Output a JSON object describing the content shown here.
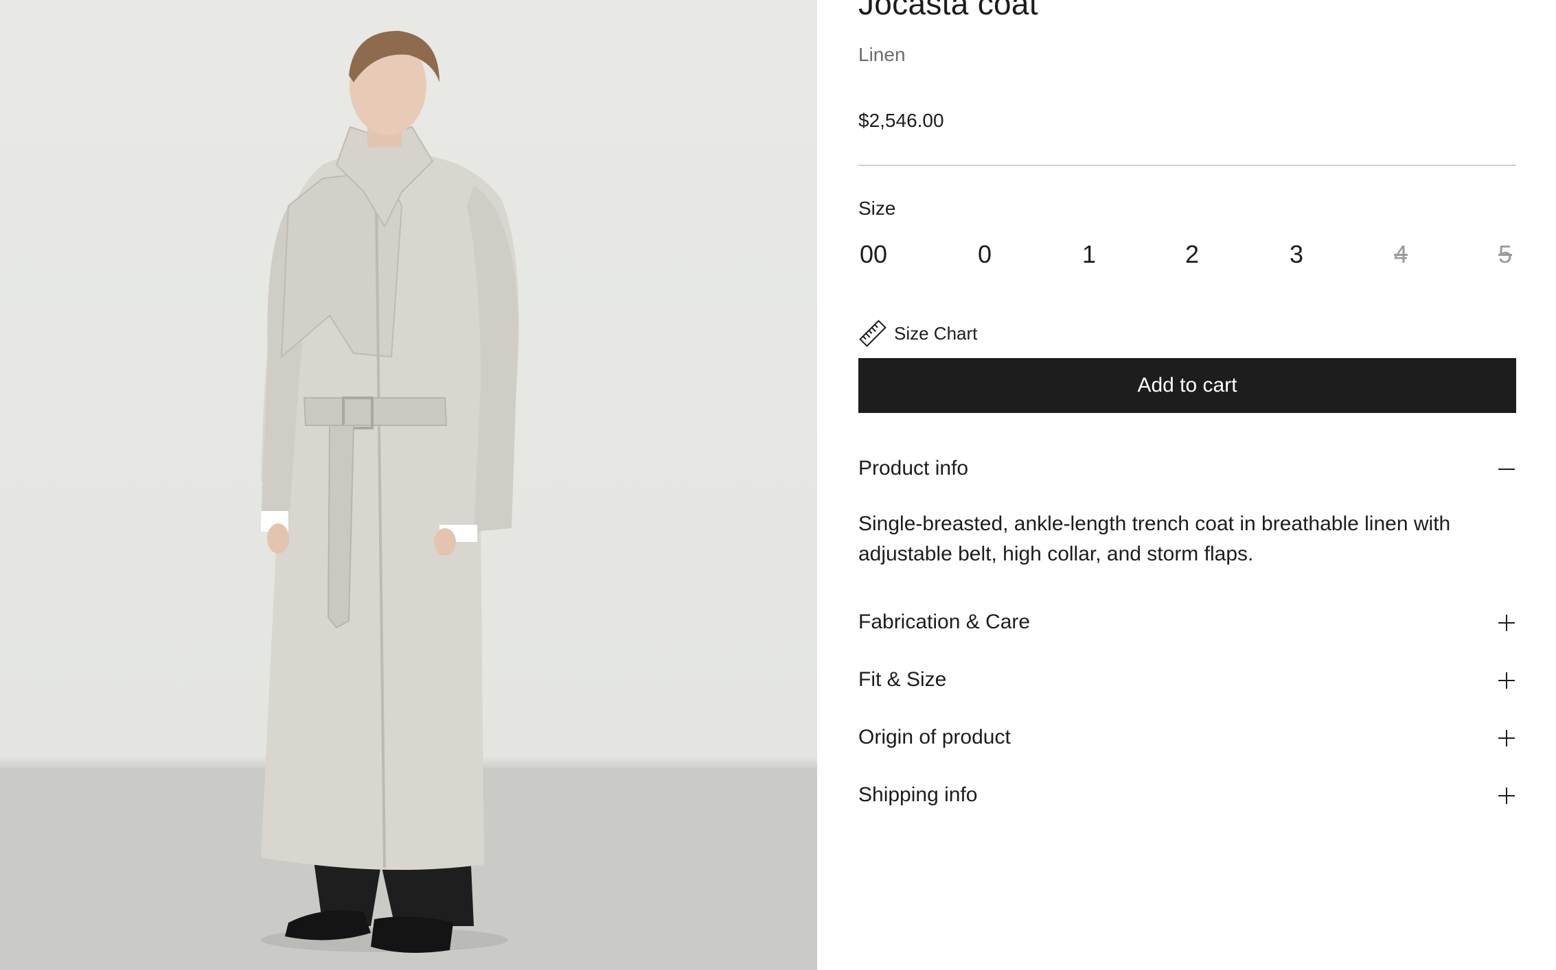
{
  "product": {
    "title": "Jocasta coat",
    "material": "Linen",
    "price": "$2,546.00"
  },
  "size_selector": {
    "label": "Size",
    "options": [
      {
        "label": "00",
        "available": true
      },
      {
        "label": "0",
        "available": true
      },
      {
        "label": "1",
        "available": true
      },
      {
        "label": "2",
        "available": true
      },
      {
        "label": "3",
        "available": true
      },
      {
        "label": "4",
        "available": false
      },
      {
        "label": "5",
        "available": false
      }
    ]
  },
  "size_chart": {
    "label": "Size Chart",
    "icon": "ruler-icon"
  },
  "cart": {
    "button_label": "Add to cart"
  },
  "accordion": {
    "product_info": {
      "label": "Product info",
      "expanded": true,
      "content": "Single-breasted, ankle-length trench coat in breathable linen with adjustable belt, high collar, and storm flaps."
    },
    "items": [
      {
        "label": "Fabrication & Care",
        "expanded": false
      },
      {
        "label": "Fit & Size",
        "expanded": false
      },
      {
        "label": "Origin of product",
        "expanded": false
      },
      {
        "label": "Shipping info",
        "expanded": false
      }
    ]
  },
  "colors": {
    "button_bg": "#1d1d1d",
    "text": "#1c1c1c",
    "muted_text": "#6b6b6b",
    "unavailable": "#9a9a9a"
  }
}
